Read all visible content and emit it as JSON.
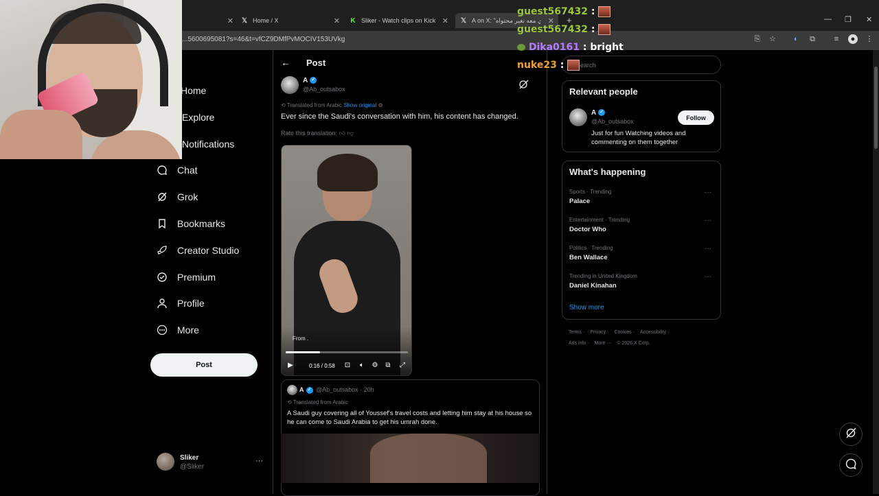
{
  "browser": {
    "tabs": [
      {
        "title": "Home / X"
      },
      {
        "title": "Sliker - Watch clips on Kick"
      },
      {
        "title": "A on X: \"ذي معه تغير محتواه"
      }
    ],
    "url": "...5600695081?s=46&t=vfCZ9DMfPvMOCIV153UVkg"
  },
  "nav": {
    "items": [
      {
        "label": "Home"
      },
      {
        "label": "Explore"
      },
      {
        "label": "Notifications"
      },
      {
        "label": "Chat"
      },
      {
        "label": "Grok"
      },
      {
        "label": "Bookmarks"
      },
      {
        "label": "Creator Studio"
      },
      {
        "label": "Premium"
      },
      {
        "label": "Profile"
      },
      {
        "label": "More"
      }
    ],
    "post_button": "Post",
    "account": {
      "name": "Sliker",
      "handle": "@Sliker",
      "more": "···"
    }
  },
  "main": {
    "header": "Post",
    "author": {
      "name": "A",
      "handle": "@Ab_outsabox"
    },
    "translated_from": "Translated from Arabic",
    "show_original": "Show original",
    "text": "Ever since the Saudi's conversation with him, his content has changed.",
    "rate_translation": "Rate this translation:",
    "video": {
      "from_label": "From",
      "time": "0:16 / 0:58",
      "progress": 0.28
    }
  },
  "quote": {
    "name": "A",
    "handle_time": "@Ab_outsabox · 20h",
    "translated_from": "Translated from Arabic",
    "text": "A Saudi guy covering all of Youssef's travel costs and letting him stay at his house so he can come to Saudi Arabia to get his umrah done."
  },
  "right": {
    "search_placeholder": "Search",
    "relevant_people": {
      "title": "Relevant people",
      "name": "A",
      "handle": "@Ab_outsabox",
      "bio": "Just for fun Watching videos and commenting on them together",
      "follow": "Follow"
    },
    "happening": {
      "title": "What's happening",
      "trends": [
        {
          "meta": "Sports · Trending",
          "name": "Palace"
        },
        {
          "meta": "Entertainment · Trending",
          "name": "Doctor Who"
        },
        {
          "meta": "Politics · Trending",
          "name": "Ben Wallace"
        },
        {
          "meta": "Trending in United Kingdom",
          "name": "Daniel Kinahan"
        }
      ],
      "show_more": "Show more"
    },
    "footer": {
      "line1": [
        "Terms",
        "Privacy",
        "Cookies",
        "Accessibility"
      ],
      "line2": [
        "Ads info",
        "More ···",
        "© 2026 X Corp."
      ]
    }
  },
  "chat": [
    {
      "user": "guest567432",
      "sep": ":",
      "color": "#9bc53d"
    },
    {
      "user": "guest567432",
      "sep": ":",
      "color": "#9bc53d"
    },
    {
      "user": "Dika0161",
      "sep": ": bright",
      "color": "#b57bff"
    },
    {
      "user": "nuke23",
      "sep": ":",
      "color": "#f0a030"
    }
  ]
}
